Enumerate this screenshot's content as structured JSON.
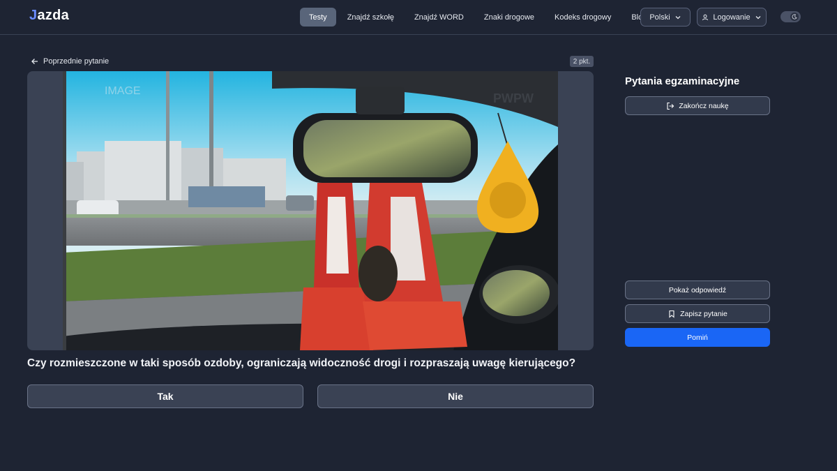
{
  "header": {
    "logo_prefix": "J",
    "logo_rest": "azda",
    "nav": [
      {
        "label": "Testy",
        "active": true
      },
      {
        "label": "Znajdź szkołę",
        "active": false
      },
      {
        "label": "Znajdź WORD",
        "active": false
      },
      {
        "label": "Znaki drogowe",
        "active": false
      },
      {
        "label": "Kodeks drogowy",
        "active": false
      },
      {
        "label": "Blog",
        "active": false
      }
    ],
    "language": "Polski",
    "login": "Logowanie",
    "theme_icon": "moon-icon"
  },
  "question": {
    "prev_label": "Poprzednie pytanie",
    "points": "2 pkt.",
    "text": "Czy rozmieszczone w taki sposób ozdoby, ograniczają widoczność drogi i rozpraszają uwagę kierującego?",
    "answers": [
      "Tak",
      "Nie"
    ],
    "watermark_left": "IMAGE",
    "watermark_right": "PWPW"
  },
  "sidebar": {
    "title": "Pytania egzaminacyjne",
    "end_label": "Zakończ naukę",
    "show_label": "Pokaż odpowiedź",
    "save_label": "Zapisz pytanie",
    "skip_label": "Pomiń"
  },
  "colors": {
    "background": "#1e2433",
    "accent": "#1a66f5",
    "active_nav": "#59657a"
  }
}
